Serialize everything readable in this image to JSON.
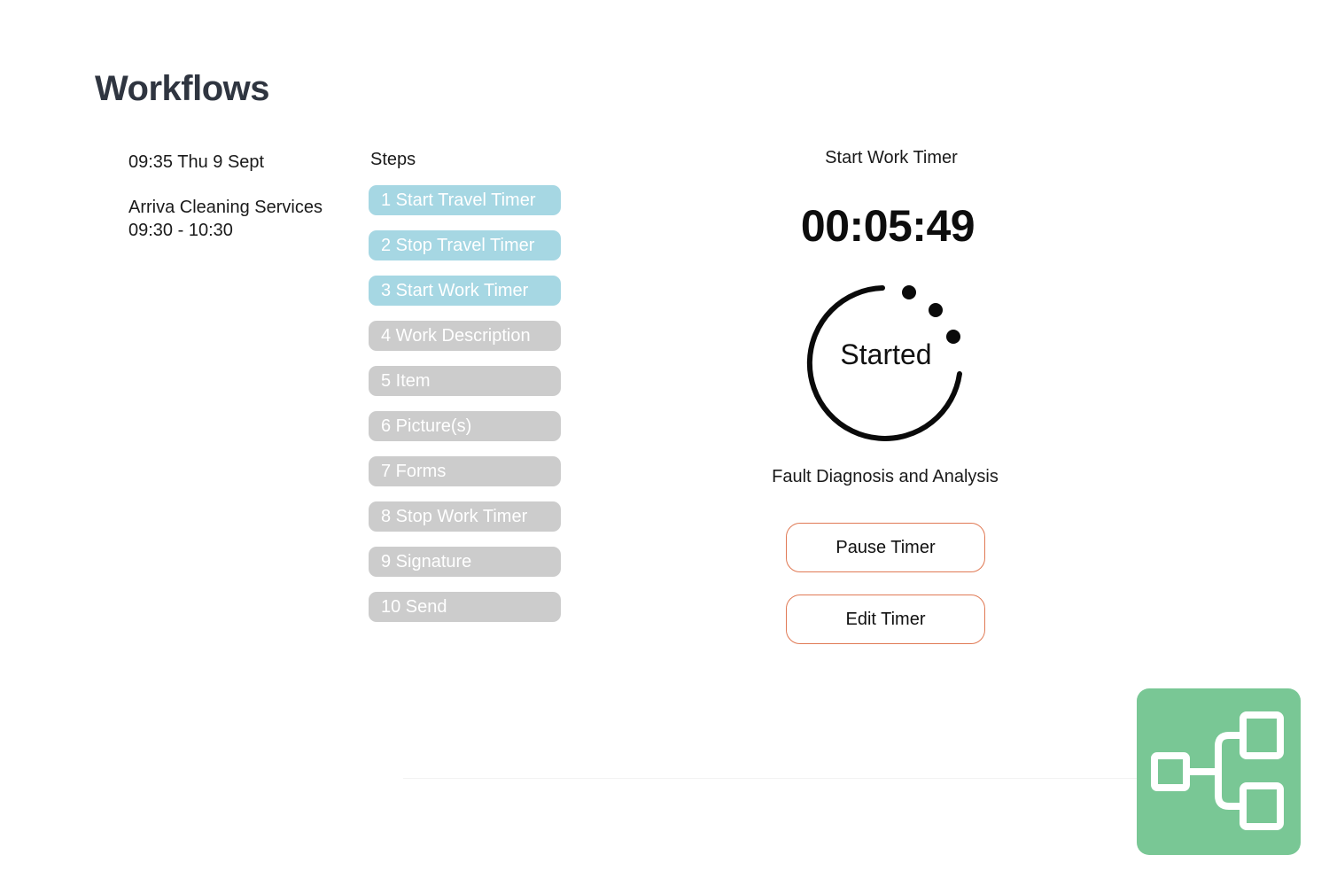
{
  "page": {
    "title": "Workflows"
  },
  "job": {
    "datetime": "09:35 Thu 9 Sept",
    "client": "Arriva Cleaning Services",
    "time_window": "09:30 - 10:30"
  },
  "steps": {
    "heading": "Steps",
    "items": [
      {
        "label": "1 Start Travel Timer",
        "status": "done"
      },
      {
        "label": "2 Stop Travel Timer",
        "status": "done"
      },
      {
        "label": "3 Start Work Timer",
        "status": "done"
      },
      {
        "label": "4 Work Description",
        "status": "todo"
      },
      {
        "label": "5 Item",
        "status": "todo"
      },
      {
        "label": "6 Picture(s)",
        "status": "todo"
      },
      {
        "label": "7 Forms",
        "status": "todo"
      },
      {
        "label": "8 Stop Work Timer",
        "status": "todo"
      },
      {
        "label": "9 Signature",
        "status": "todo"
      },
      {
        "label": "10 Send",
        "status": "todo"
      }
    ]
  },
  "timer": {
    "title": "Start Work Timer",
    "elapsed": "00:05:49",
    "state_label": "Started",
    "task": "Fault Diagnosis and Analysis",
    "pause_label": "Pause Timer",
    "edit_label": "Edit Timer"
  },
  "icons": {
    "logo": "workflow-diagram-icon",
    "status_ring": "progress-ring-icon"
  },
  "colors": {
    "step_done": "#a6d7e3",
    "step_todo": "#cccccc",
    "button_border": "#e07a55",
    "logo_background": "#79c795"
  }
}
